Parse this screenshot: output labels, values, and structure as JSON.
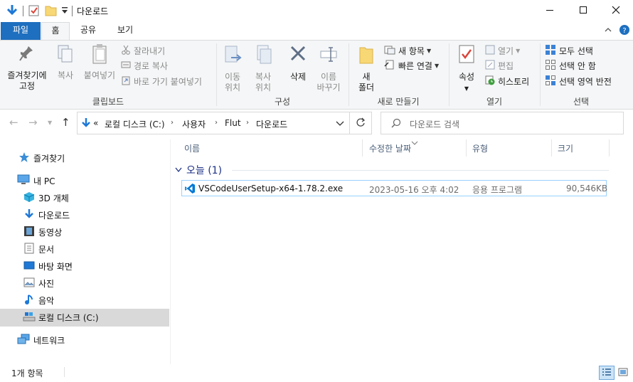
{
  "window": {
    "title": "다운로드",
    "minimize_icon": "minimize-icon",
    "maximize_icon": "maximize-icon",
    "close_icon": "close-icon"
  },
  "ribbon_tabs": [
    "파일",
    "홈",
    "공유",
    "보기"
  ],
  "ribbon": {
    "clipboard": {
      "label": "클립보드",
      "pin": "즐겨찾기에\n고정",
      "copy": "복사",
      "paste": "붙여넣기",
      "cut": "잘라내기",
      "copy_path": "경로 복사",
      "paste_shortcut": "바로 가기 붙여넣기"
    },
    "organize": {
      "label": "구성",
      "move_to": "이동\n위치",
      "copy_to": "복사\n위치",
      "delete": "삭제",
      "rename": "이름\n바꾸기"
    },
    "new": {
      "label": "새로 만들기",
      "new_folder": "새\n폴더",
      "new_item": "새 항목",
      "easy_access": "빠른 연결"
    },
    "open": {
      "label": "열기",
      "properties": "속성",
      "open": "열기",
      "edit": "편집",
      "history": "히스토리"
    },
    "select": {
      "label": "선택",
      "select_all": "모두 선택",
      "select_none": "선택 안 함",
      "invert": "선택 영역 반전"
    }
  },
  "address": {
    "overflow": "«",
    "crumbs": [
      "로컬 디스크 (C:)",
      "사용자",
      "Flut",
      "다운로드"
    ],
    "search_placeholder": "다운로드 검색"
  },
  "nav": {
    "quick_access": "즐겨찾기",
    "this_pc": "내 PC",
    "items": [
      "3D 개체",
      "다운로드",
      "동영상",
      "문서",
      "바탕 화면",
      "사진",
      "음악",
      "로컬 디스크 (C:)"
    ],
    "network": "네트워크"
  },
  "columns": [
    "이름",
    "수정한 날짜",
    "유형",
    "크기"
  ],
  "group": {
    "label": "오늘 (1)"
  },
  "files": [
    {
      "name": "VSCodeUserSetup-x64-1.78.2.exe",
      "modified": "2023-05-16 오후 4:02",
      "type": "응용 프로그램",
      "size": "90,546KB"
    }
  ],
  "status": {
    "count": "1개 항목"
  },
  "colors": {
    "file_tab": "#1e6fbf",
    "selection_border": "#99d1ff",
    "group_header": "#1e3287",
    "nav_selected": "#d9d9d9",
    "vscode_blue": "#0078d4"
  }
}
